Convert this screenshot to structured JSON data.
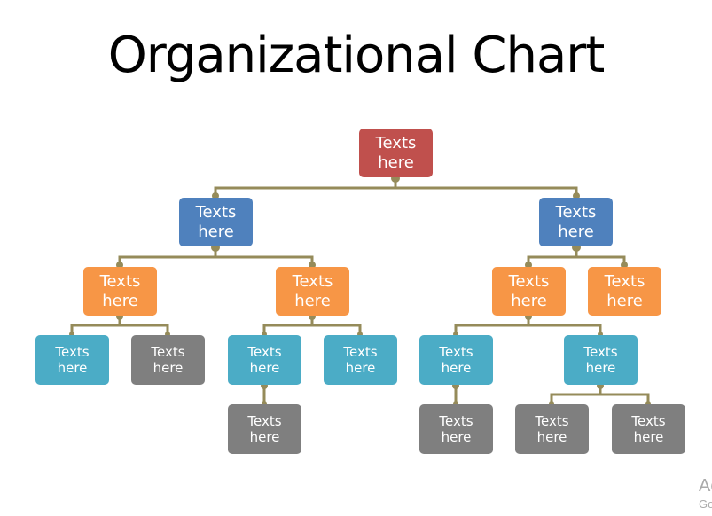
{
  "title": "Organizational Chart",
  "colors": {
    "connector": "#958b5a",
    "level0": "#c0504d",
    "level1": "#4f81bd",
    "level2": "#f79646",
    "level3": "#4bacc6",
    "leaf": "#7f7f7f"
  },
  "nodes": {
    "root": {
      "line1": "Texts",
      "line2": "here"
    },
    "l1_left": {
      "line1": "Texts",
      "line2": "here"
    },
    "l1_right": {
      "line1": "Texts",
      "line2": "here"
    },
    "l2_a": {
      "line1": "Texts",
      "line2": "here"
    },
    "l2_b": {
      "line1": "Texts",
      "line2": "here"
    },
    "l2_c": {
      "line1": "Texts",
      "line2": "here"
    },
    "l2_d": {
      "line1": "Texts",
      "line2": "here"
    },
    "l3_a1": {
      "line1": "Texts",
      "line2": "here"
    },
    "l3_a2": {
      "line1": "Texts",
      "line2": "here"
    },
    "l3_b1": {
      "line1": "Texts",
      "line2": "here"
    },
    "l3_b2": {
      "line1": "Texts",
      "line2": "here"
    },
    "l3_c1": {
      "line1": "Texts",
      "line2": "here"
    },
    "l3_c2": {
      "line1": "Texts",
      "line2": "here"
    },
    "l4_b1": {
      "line1": "Texts",
      "line2": "here"
    },
    "l4_c1": {
      "line1": "Texts",
      "line2": "here"
    },
    "l4_c2a": {
      "line1": "Texts",
      "line2": "here"
    },
    "l4_c2b": {
      "line1": "Texts",
      "line2": "here"
    }
  },
  "watermark": {
    "line1": "Ac",
    "line2": "Go"
  }
}
